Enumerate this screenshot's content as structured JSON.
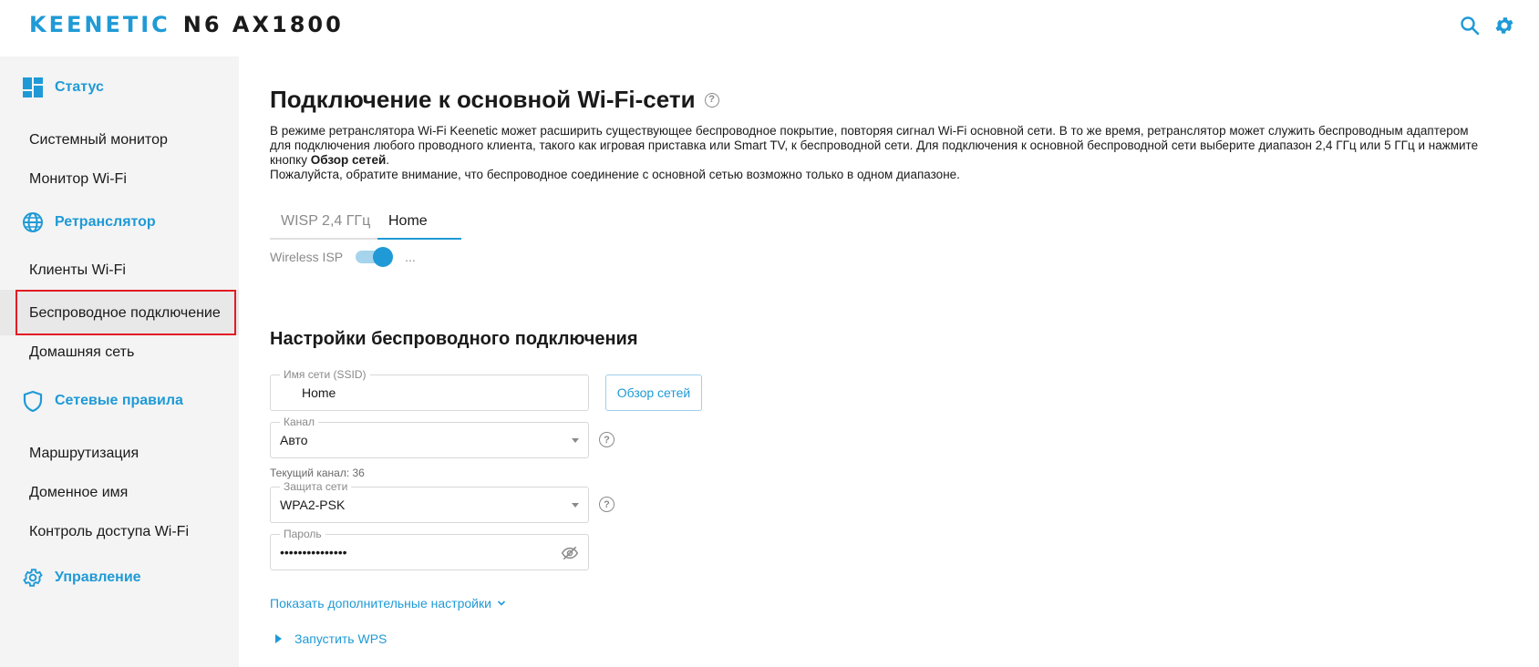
{
  "header": {
    "brand": "KEENETIC",
    "model": "N6 AX1800",
    "icons": [
      "search-icon",
      "gear-icon"
    ]
  },
  "sidebar": {
    "sections": [
      {
        "title": "Статус",
        "icon": "dashboard-icon",
        "items": [
          "Системный монитор",
          "Монитор Wi-Fi"
        ]
      },
      {
        "title": "Ретранслятор",
        "icon": "globe-icon",
        "items": [
          "Клиенты Wi-Fi",
          "Беспроводное подключение",
          "Домашняя сеть"
        ]
      },
      {
        "title": "Сетевые правила",
        "icon": "shield-icon",
        "items": [
          "Маршрутизация",
          "Доменное имя",
          "Контроль доступа Wi-Fi"
        ]
      },
      {
        "title": "Управление",
        "icon": "gear-icon",
        "items": []
      }
    ],
    "active_item": "Беспроводное подключение"
  },
  "main": {
    "title": "Подключение к основной Wi-Fi-сети",
    "description": {
      "line1": "В режиме ретранслятора Wi-Fi Keenetic может расширить существующее беспроводное покрытие, повторяя сигнал Wi-Fi основной сети. В то же время, ретранслятор может служить беспроводным адаптером для подключения любого проводного клиента, такого как игровая приставка или Smart TV, к беспроводной сети. Для подключения к основной беспроводной сети выберите диапазон 2,4 ГГц или 5 ГГц и нажмите кнопку ",
      "bold": "Обзор сетей",
      "line1_end": ".",
      "line2": "Пожалуйста, обратите внимание, что беспроводное соединение с основной сетью возможно только в одном диапазоне."
    },
    "tabs": [
      {
        "label": "WISP 2,4 ГГц",
        "active": false
      },
      {
        "label": "Home",
        "active": true
      }
    ],
    "toggle": {
      "label": "Wireless ISP",
      "on": true,
      "more": "..."
    },
    "settings_title": "Настройки беспроводного подключения",
    "ssid": {
      "label": "Имя сети (SSID)",
      "value": "Home"
    },
    "scan_button": "Обзор сетей",
    "channel": {
      "label": "Канал",
      "value": "Авто",
      "hint": "Текущий канал: 36"
    },
    "security": {
      "label": "Защита сети",
      "value": "WPA2-PSK"
    },
    "password": {
      "label": "Пароль",
      "value": "•••••••••••••••"
    },
    "advanced_link": "Показать дополнительные настройки",
    "wps_link": "Запустить WPS",
    "colors": {
      "accent": "#1f9ad6",
      "highlight": "#e31b23"
    }
  }
}
